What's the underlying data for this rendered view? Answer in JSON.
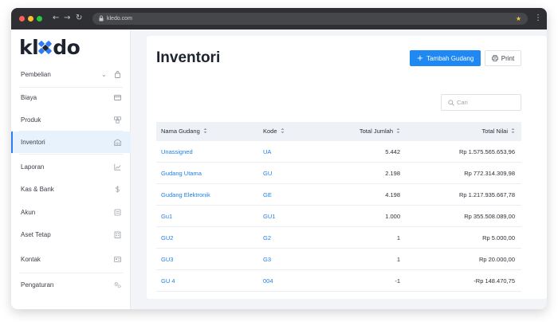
{
  "browser": {
    "url": "kledo.com",
    "back_glyph": "←",
    "forward_glyph": "→",
    "reload_glyph": "↻",
    "star_glyph": "★",
    "menu_glyph": "⋮"
  },
  "brand": {
    "logo_left": "kl",
    "logo_right": "do",
    "accent": "#2e7df6"
  },
  "sidebar": {
    "chevron": "⌄",
    "items": [
      {
        "label": "Pembelian",
        "icon": "bag-icon"
      },
      {
        "label": "Biaya",
        "icon": "card-icon"
      },
      {
        "label": "Produk",
        "icon": "boxes-icon"
      },
      {
        "label": "Inventori",
        "icon": "warehouse-icon",
        "active": true
      },
      {
        "label": "Laporan",
        "icon": "chart-icon"
      },
      {
        "label": "Kas & Bank",
        "icon": "dollar-icon"
      },
      {
        "label": "Akun",
        "icon": "ledger-icon"
      },
      {
        "label": "Aset Tetap",
        "icon": "building-icon"
      },
      {
        "label": "Kontak",
        "icon": "contact-card-icon"
      },
      {
        "label": "Pengaturan",
        "icon": "gears-icon"
      }
    ]
  },
  "main": {
    "title": "Inventori",
    "add_button": {
      "icon": "+",
      "label": "Tambah Gudang"
    },
    "print_button": {
      "label": "Print"
    },
    "search": {
      "placeholder": "Cari",
      "value": ""
    }
  },
  "table": {
    "columns": [
      "Nama Gudang",
      "Kode",
      "Total Jumlah",
      "Total Nilai"
    ],
    "rows": [
      {
        "name": "Unassigned",
        "code": "UA",
        "qty": "5.442",
        "value": "Rp 1.575.565.653,96"
      },
      {
        "name": "Gudang Utama",
        "code": "GU",
        "qty": "2.198",
        "value": "Rp 772.314.309,98"
      },
      {
        "name": "Gudang Elektronik",
        "code": "GE",
        "qty": "4.198",
        "value": "Rp 1.217.935.667,78"
      },
      {
        "name": "Gu1",
        "code": "GU1",
        "qty": "1.000",
        "value": "Rp 355.508.089,00"
      },
      {
        "name": "GU2",
        "code": "G2",
        "qty": "1",
        "value": "Rp 5.000,00"
      },
      {
        "name": "GU3",
        "code": "G3",
        "qty": "1",
        "value": "Rp 20.000,00"
      },
      {
        "name": "GU 4",
        "code": "004",
        "qty": "-1",
        "value": "-Rp 148.470,75"
      }
    ]
  }
}
